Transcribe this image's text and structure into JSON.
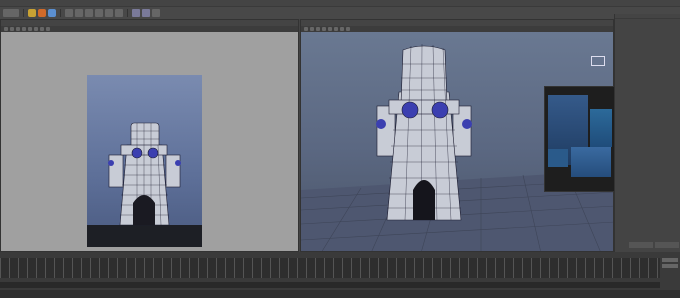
{
  "colors": {
    "left_viewport_bg": "#a0a0a0",
    "right_viewport_sky": "#6b7a93",
    "grid_floor": "#4a5467",
    "model_wire": "#1a1a2e",
    "model_fill": "#c8ccd6",
    "porthole": "#3b3fb0",
    "ui_dark": "#444444"
  },
  "icons": {
    "logo": "maya-logo-icon",
    "snap": "magnet-icon"
  }
}
